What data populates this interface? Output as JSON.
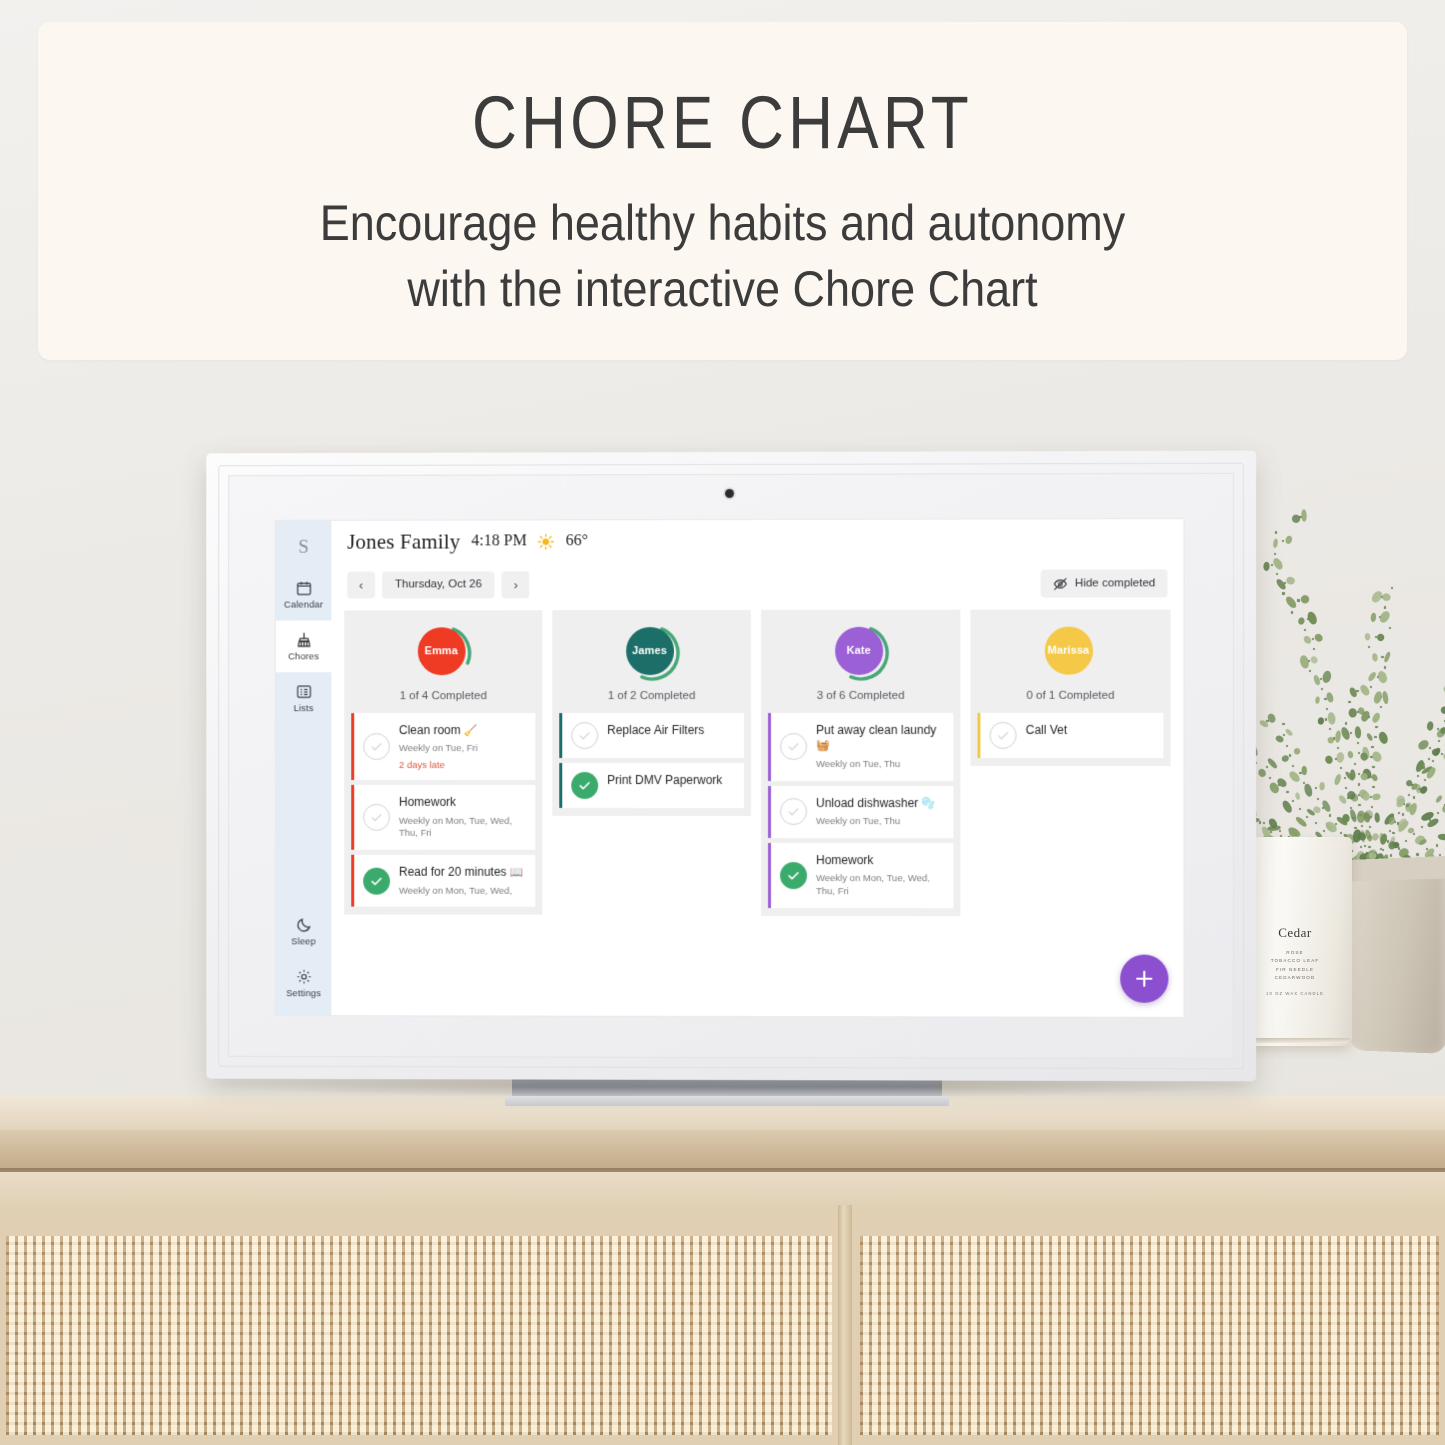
{
  "banner": {
    "title": "CHORE CHART",
    "subtitle_line1": "Encourage healthy habits and autonomy",
    "subtitle_line2": "with the interactive Chore Chart"
  },
  "scene": {
    "candle": {
      "name": "Cedar",
      "notes": "ROSE\nTOBACCO LEAF\nFIR NEEDLE\nCEDARWOOD",
      "sub": "10 OZ WAX CANDLE"
    }
  },
  "app": {
    "sidebar": {
      "brand": "S",
      "items": [
        {
          "label": "Calendar",
          "icon": "calendar-icon",
          "active": false
        },
        {
          "label": "Chores",
          "icon": "broom-icon",
          "active": true
        },
        {
          "label": "Lists",
          "icon": "list-icon",
          "active": false
        }
      ],
      "bottom_items": [
        {
          "label": "Sleep",
          "icon": "moon-icon",
          "active": false
        },
        {
          "label": "Settings",
          "icon": "gear-icon",
          "active": false
        }
      ]
    },
    "topbar": {
      "family_name": "Jones Family",
      "time": "4:18 PM",
      "weather_icon": "sun-icon",
      "temperature": "66°"
    },
    "datebar": {
      "prev_label": "‹",
      "next_label": "›",
      "current_date": "Thursday, Oct 26",
      "hide_completed_label": "Hide completed",
      "hide_completed_icon": "eye-off-icon"
    },
    "fab": {
      "icon": "plus-icon",
      "label": "Add chore"
    },
    "colors": {
      "emma": "#ef3b24",
      "james": "#1c6e68",
      "kate": "#9b5fd6",
      "marissa": "#f5c847",
      "done_green": "#3bab6d",
      "ring_green": "#46a777",
      "late_red": "#e0553b",
      "fab_purple": "#8b4fcf"
    },
    "columns": [
      {
        "name": "Emma",
        "avatar_color": "#ef3b24",
        "accent": "#ef3b24",
        "progress_text": "1 of 4 Completed",
        "completed": 1,
        "total": 4,
        "tasks": [
          {
            "title": "Clean room",
            "emoji": "🧹",
            "schedule": "Weekly on Tue, Fri",
            "late": "2 days late",
            "done": false
          },
          {
            "title": "Homework",
            "emoji": "",
            "schedule": "Weekly on Mon, Tue, Wed, Thu, Fri",
            "late": "",
            "done": false
          },
          {
            "title": "Read for 20 minutes",
            "emoji": "📖",
            "schedule": "Weekly on Mon, Tue, Wed,",
            "late": "",
            "done": true
          }
        ]
      },
      {
        "name": "James",
        "avatar_color": "#1c6e68",
        "accent": "#1c6e68",
        "progress_text": "1 of 2 Completed",
        "completed": 1,
        "total": 2,
        "tasks": [
          {
            "title": "Replace Air Filters",
            "emoji": "",
            "schedule": "",
            "late": "",
            "done": false
          },
          {
            "title": "Print DMV Paperwork",
            "emoji": "",
            "schedule": "",
            "late": "",
            "done": true
          }
        ]
      },
      {
        "name": "Kate",
        "avatar_color": "#9b5fd6",
        "accent": "#9b5fd6",
        "progress_text": "3 of 6 Completed",
        "completed": 3,
        "total": 6,
        "tasks": [
          {
            "title": "Put away clean laundy",
            "emoji": "🧺",
            "schedule": "Weekly on Tue, Thu",
            "late": "",
            "done": false
          },
          {
            "title": "Unload dishwasher",
            "emoji": "🫧",
            "schedule": "Weekly on Tue, Thu",
            "late": "",
            "done": false
          },
          {
            "title": "Homework",
            "emoji": "",
            "schedule": "Weekly on Mon, Tue, Wed, Thu, Fri",
            "late": "",
            "done": true
          }
        ]
      },
      {
        "name": "Marissa",
        "avatar_color": "#f5c847",
        "accent": "#f5c847",
        "progress_text": "0 of 1 Completed",
        "completed": 0,
        "total": 1,
        "tasks": [
          {
            "title": "Call Vet",
            "emoji": "",
            "schedule": "",
            "late": "",
            "done": false
          }
        ]
      }
    ]
  }
}
